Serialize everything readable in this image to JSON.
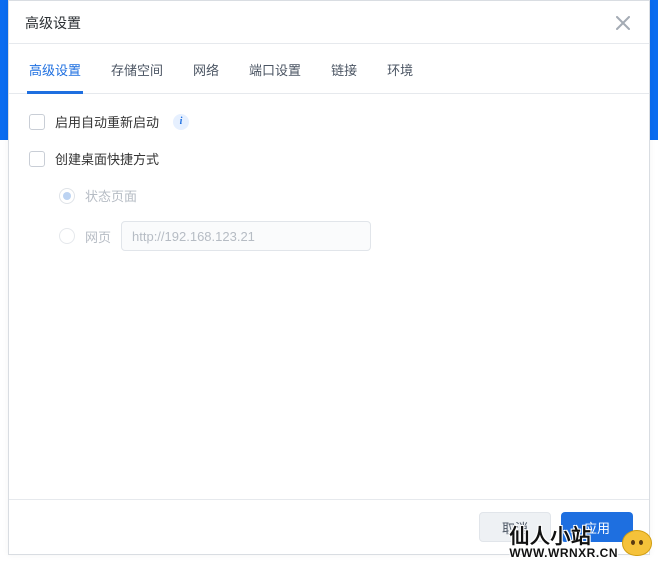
{
  "dialog": {
    "title": "高级设置"
  },
  "tabs": [
    {
      "label": "高级设置",
      "active": true
    },
    {
      "label": "存储空间",
      "active": false
    },
    {
      "label": "网络",
      "active": false
    },
    {
      "label": "端口设置",
      "active": false
    },
    {
      "label": "链接",
      "active": false
    },
    {
      "label": "环境",
      "active": false
    }
  ],
  "options": {
    "auto_restart_label": "启用自动重新启动",
    "desktop_shortcut_label": "创建桌面快捷方式",
    "status_page_label": "状态页面",
    "web_page_label": "网页",
    "url_value": "",
    "url_placeholder": "http://192.168.123.21"
  },
  "footer": {
    "cancel_label": "取消",
    "apply_label": "应用"
  },
  "watermark": {
    "title": "仙人小站",
    "url": "WWW.WRNXR.CN"
  }
}
